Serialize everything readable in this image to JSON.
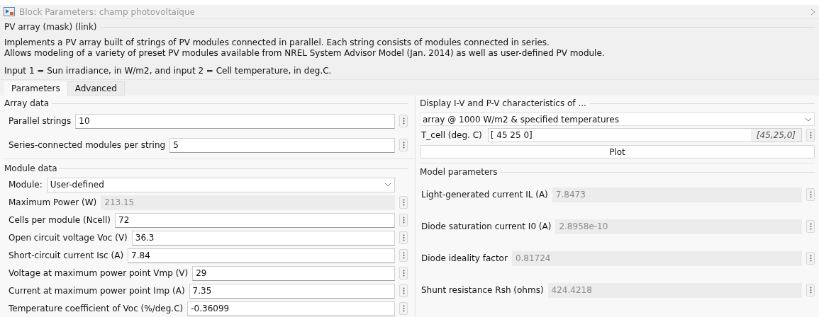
{
  "window": {
    "title": "Block Parameters: champ photovoltaïque"
  },
  "header": "PV array (mask) (link)",
  "description": [
    "Implements a PV array built of strings of PV modules connected in parallel. Each string consists of modules connected in series.",
    "Allows modeling of a variety of preset PV modules available from NREL System Advisor Model (Jan. 2014) as well as user-defined PV module."
  ],
  "inputs_note": "Input 1 = Sun irradiance, in W/m2, and input 2 = Cell temperature, in deg.C.",
  "tabs": [
    {
      "label": "Parameters",
      "selected": true
    },
    {
      "label": "Advanced",
      "selected": false
    }
  ],
  "array_data": {
    "title": "Array data",
    "fields": [
      {
        "kind": "edit",
        "label": "Parallel strings",
        "value": "10"
      },
      {
        "kind": "edit",
        "label": "Series-connected modules per string",
        "value": "5"
      }
    ]
  },
  "module_data": {
    "title": "Module data",
    "fields": [
      {
        "kind": "dropdown",
        "label": "Module:",
        "value": "User-defined"
      },
      {
        "kind": "disabled",
        "label": "Maximum Power (W)",
        "value": "213.15"
      },
      {
        "kind": "edit",
        "label": "Cells per module (Ncell)",
        "value": "72"
      },
      {
        "kind": "edit",
        "label": "Open circuit voltage  Voc (V)",
        "value": "36.3"
      },
      {
        "kind": "edit",
        "label": "Short-circuit current Isc (A)",
        "value": "7.84"
      },
      {
        "kind": "edit",
        "label": "Voltage at maximum power point Vmp (V)",
        "value": "29"
      },
      {
        "kind": "edit",
        "label": "Current at maximum power point Imp (A)",
        "value": "7.35"
      },
      {
        "kind": "edit",
        "label": "Temperature coefficient of Voc (%/deg.C)",
        "value": "-0.36099"
      }
    ]
  },
  "display": {
    "title": "Display  I-V and P-V characteristics of ...",
    "selection": "array @ 1000 W/m2 & specified temperatures",
    "t_cell": {
      "label": "T_cell (deg. C)",
      "value": "[ 45 25  0]",
      "evaluated": "[45,25,0]"
    },
    "button": "Plot"
  },
  "model_parameters": {
    "title": "Model parameters",
    "fields": [
      {
        "kind": "disabled",
        "label": "Light-generated current IL (A)",
        "value": "7.8473"
      },
      {
        "kind": "disabled",
        "label": "Diode saturation current I0 (A)",
        "value": "2.8958e-10"
      },
      {
        "kind": "disabled",
        "label": "Diode ideality factor",
        "value": "0.81724"
      },
      {
        "kind": "disabled",
        "label": "Shunt resistance Rsh (ohms)",
        "value": "424.4218"
      }
    ]
  }
}
